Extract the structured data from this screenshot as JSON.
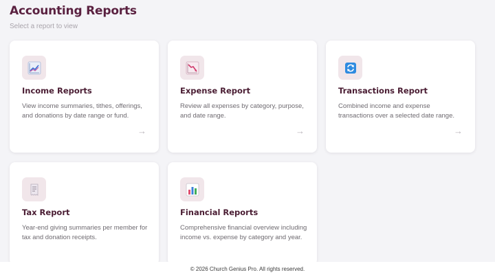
{
  "header": {
    "title": "Accounting Reports",
    "subtitle": "Select a report to view"
  },
  "cards": [
    {
      "title": "Income Reports",
      "description": "View income summaries, tithes, offerings, and donations by date range or fund.",
      "icon": "line-chart-icon",
      "arrow": "→"
    },
    {
      "title": "Expense Report",
      "description": "Review all expenses by category, purpose, and date range.",
      "icon": "trend-down-icon",
      "arrow": "→"
    },
    {
      "title": "Transactions Report",
      "description": "Combined income and expense transactions over a selected date range.",
      "icon": "refresh-icon",
      "arrow": "→"
    },
    {
      "title": "Tax Report",
      "description": "Year-end giving summaries per member for tax and donation receipts.",
      "icon": "receipt-icon"
    },
    {
      "title": "Financial Reports",
      "description": "Comprehensive financial overview including income vs. expense by category and year.",
      "icon": "bar-chart-icon"
    }
  ],
  "footer": {
    "copyright": "© 2026 Church Genius Pro. All rights reserved."
  }
}
